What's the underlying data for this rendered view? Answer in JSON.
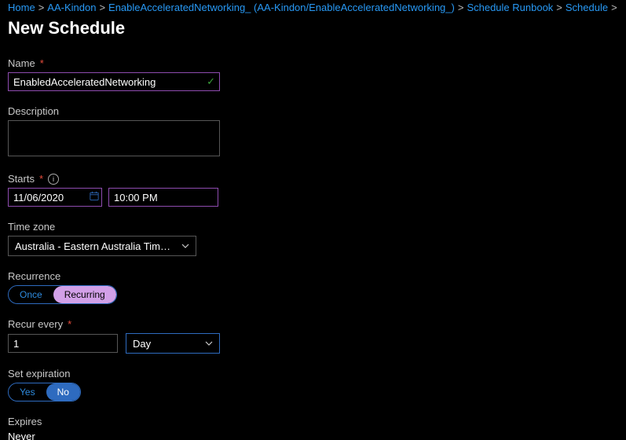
{
  "breadcrumb": {
    "home": "Home",
    "account": "AA-Kindon",
    "runbook": "EnableAcceleratedNetworking_ (AA-Kindon/EnableAcceleratedNetworking_)",
    "schedule_runbook": "Schedule Runbook",
    "schedule": "Schedule"
  },
  "page_title": "New Schedule",
  "labels": {
    "name": "Name",
    "description": "Description",
    "starts": "Starts",
    "time_zone": "Time zone",
    "recurrence": "Recurrence",
    "recur_every": "Recur every",
    "set_expiration": "Set expiration",
    "expires": "Expires"
  },
  "name_field": {
    "value": "EnabledAcceleratedNetworking"
  },
  "description_field": {
    "value": ""
  },
  "starts": {
    "date": "11/06/2020",
    "time": "10:00 PM"
  },
  "time_zone": {
    "display": "Australia - Eastern Australia Time (Sydn..."
  },
  "recurrence": {
    "options": {
      "once": "Once",
      "recurring": "Recurring"
    },
    "selected": "recurring"
  },
  "recur_every": {
    "value": "1",
    "unit": "Day"
  },
  "set_expiration": {
    "options": {
      "yes": "Yes",
      "no": "No"
    },
    "selected": "no"
  },
  "expires_value": "Never"
}
